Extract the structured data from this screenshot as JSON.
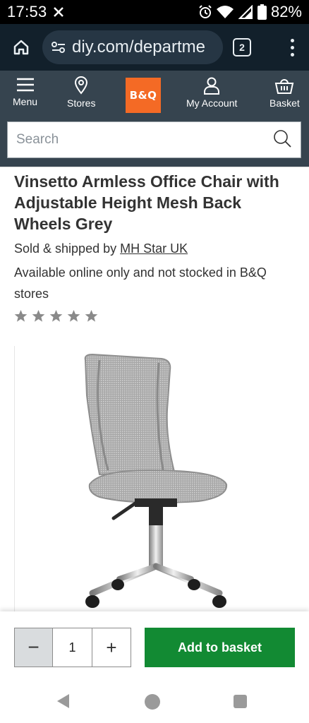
{
  "status_bar": {
    "time": "17:53",
    "battery": "82%"
  },
  "browser": {
    "url": "diy.com/departme",
    "tab_count": "2"
  },
  "header": {
    "nav": [
      {
        "label": "Menu",
        "icon": "hamburger-icon"
      },
      {
        "label": "Stores",
        "icon": "location-pin-icon"
      },
      {
        "label": "My Account",
        "icon": "user-icon"
      },
      {
        "label": "Basket",
        "icon": "basket-icon"
      }
    ],
    "logo_text": "B&Q",
    "brand_color": "#f46a25",
    "search_placeholder": "Search"
  },
  "product": {
    "title": "Vinsetto Armless Office Chair with Adjustable Height Mesh Back Wheels Grey",
    "sold_by_prefix": "Sold & shipped by",
    "seller": "MH Star UK",
    "availability": "Available online only and not stocked in B&Q stores",
    "rating": 0,
    "rating_max": 5
  },
  "basket_bar": {
    "minus_label": "−",
    "quantity": "1",
    "plus_label": "+",
    "add_button_label": "Add to basket",
    "add_button_color": "#128a33"
  }
}
